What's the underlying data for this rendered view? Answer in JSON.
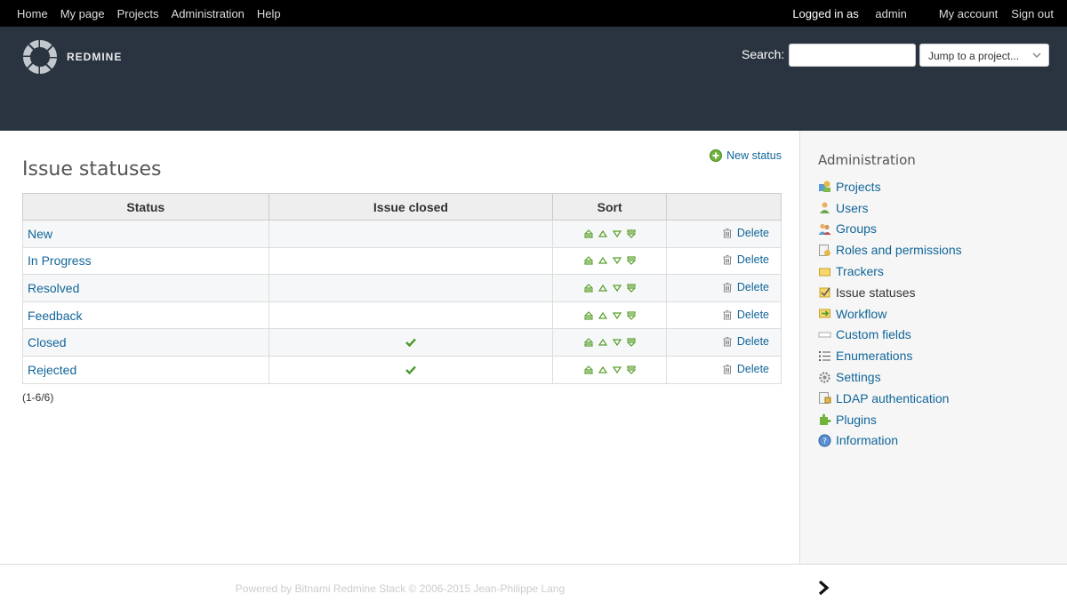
{
  "top_menu": {
    "left": [
      "Home",
      "My page",
      "Projects",
      "Administration",
      "Help"
    ],
    "logged_in_as": "Logged in as",
    "user": "admin",
    "right": [
      "My account",
      "Sign out"
    ]
  },
  "header": {
    "logo_text": "REDMINE",
    "search_label": "Search:",
    "search_value": "",
    "jump_placeholder": "Jump to a project..."
  },
  "page": {
    "title": "Issue statuses",
    "new_status_label": "New status",
    "columns": [
      "Status",
      "Issue closed",
      "Sort",
      ""
    ],
    "rows": [
      {
        "name": "New",
        "closed": false
      },
      {
        "name": "In Progress",
        "closed": false
      },
      {
        "name": "Resolved",
        "closed": false
      },
      {
        "name": "Feedback",
        "closed": false
      },
      {
        "name": "Closed",
        "closed": true
      },
      {
        "name": "Rejected",
        "closed": true
      }
    ],
    "delete_label": "Delete",
    "pagination": "(1-6/6)"
  },
  "sidebar": {
    "title": "Administration",
    "items": [
      {
        "label": "Projects",
        "icon": "projects-icon",
        "current": false
      },
      {
        "label": "Users",
        "icon": "user-icon",
        "current": false
      },
      {
        "label": "Groups",
        "icon": "group-icon",
        "current": false
      },
      {
        "label": "Roles and permissions",
        "icon": "roles-icon",
        "current": false
      },
      {
        "label": "Trackers",
        "icon": "tracker-icon",
        "current": false
      },
      {
        "label": "Issue statuses",
        "icon": "issue-status-icon",
        "current": true
      },
      {
        "label": "Workflow",
        "icon": "workflow-icon",
        "current": false
      },
      {
        "label": "Custom fields",
        "icon": "custom-fields-icon",
        "current": false
      },
      {
        "label": "Enumerations",
        "icon": "list-icon",
        "current": false
      },
      {
        "label": "Settings",
        "icon": "gear-icon",
        "current": false
      },
      {
        "label": "LDAP authentication",
        "icon": "ldap-icon",
        "current": false
      },
      {
        "label": "Plugins",
        "icon": "plugin-icon",
        "current": false
      },
      {
        "label": "Information",
        "icon": "info-icon",
        "current": false
      }
    ]
  },
  "footer": {
    "text": "Powered by Bitnami Redmine Stack © 2006-2015 Jean-Philippe Lang"
  },
  "colors": {
    "link": "#116699",
    "header_bg": "#2a3440",
    "top_menu_bg": "#000000",
    "sort_green": "#5aa02c"
  }
}
